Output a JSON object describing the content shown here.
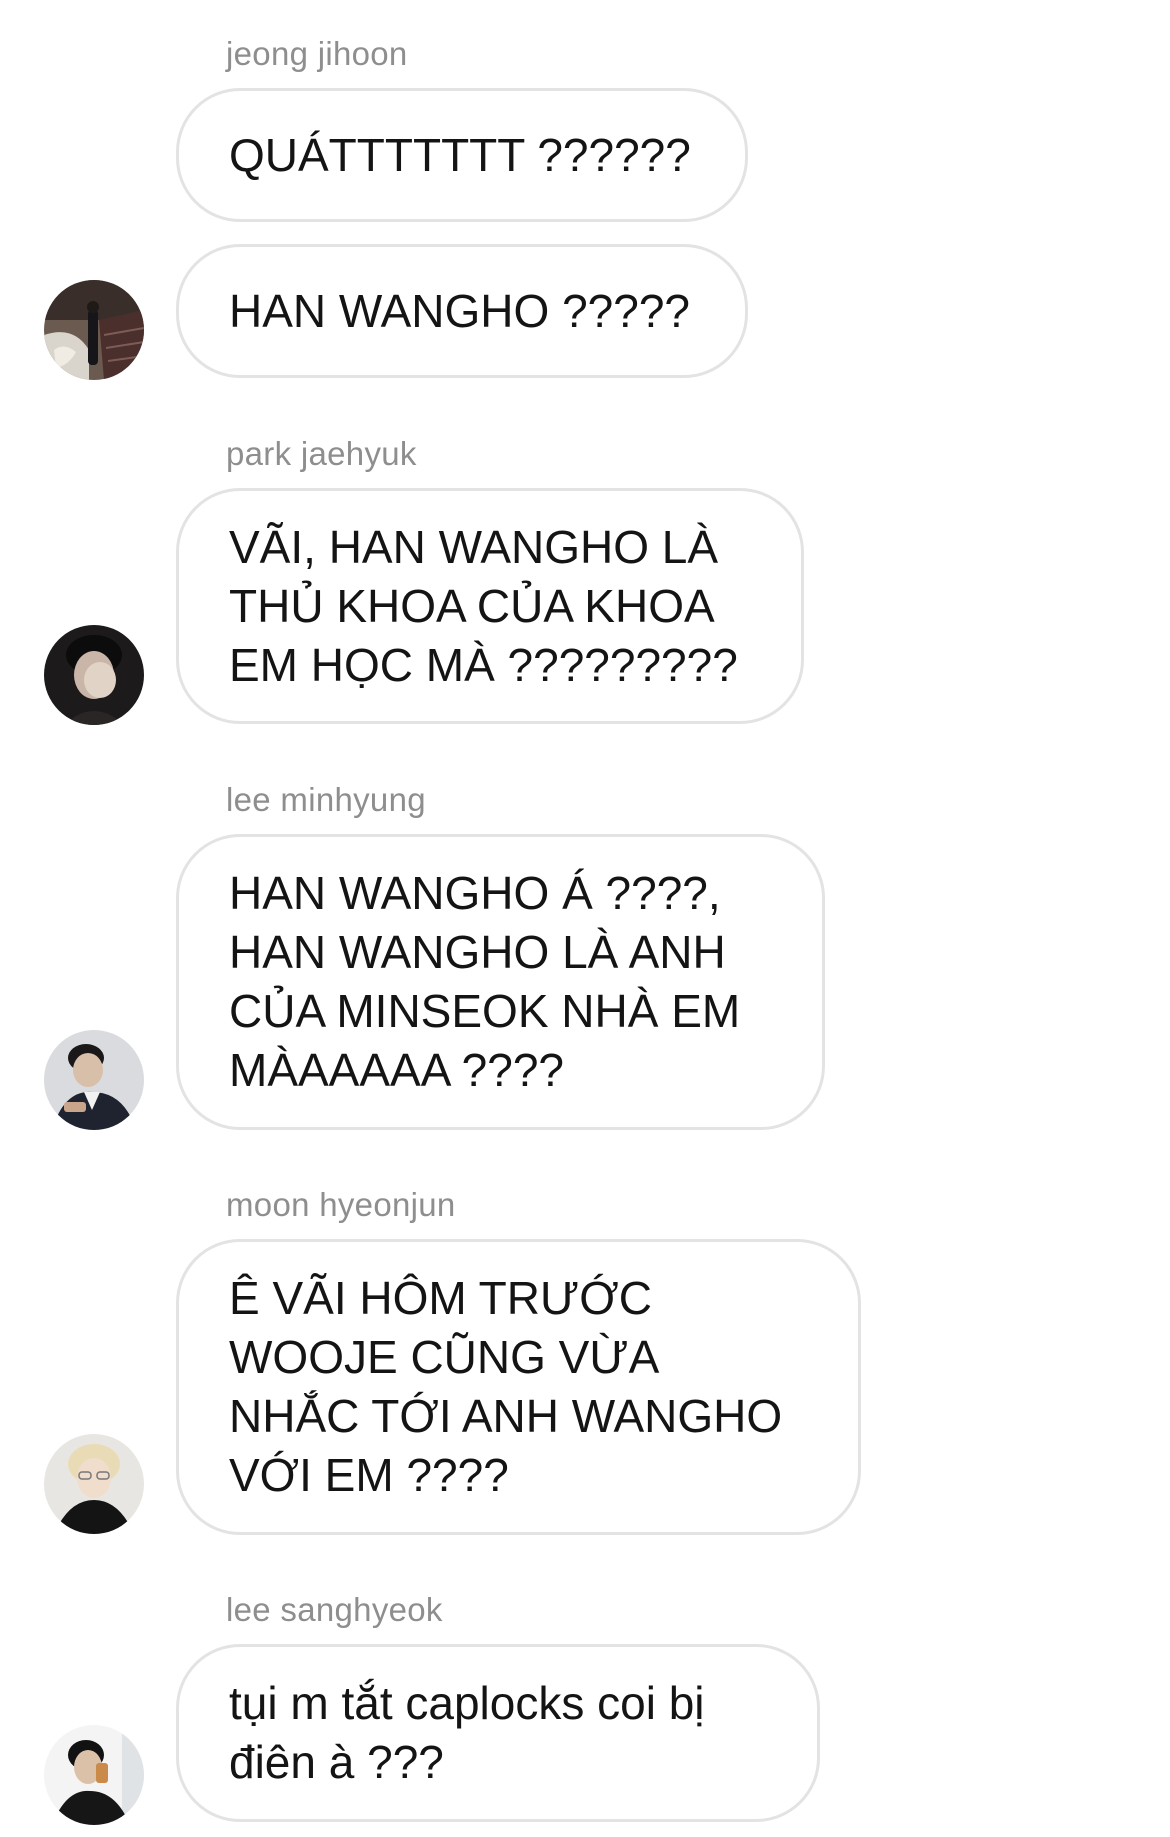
{
  "conversation": {
    "groups": [
      {
        "sender": "jeong jihoon",
        "messages": [
          "QUÁTTTTTTT ??????",
          "HAN WANGHO ?????"
        ],
        "avatar_icon": "avatar-photo-staircase"
      },
      {
        "sender": "park jaehyuk",
        "messages": [
          "VÃI, HAN WANGHO LÀ\nTHỦ KHOA CỦA KHOA\nEM HỌC MÀ ?????????"
        ],
        "avatar_icon": "avatar-photo-hand-over-face"
      },
      {
        "sender": "lee minhyung",
        "messages": [
          "HAN WANGHO Á ????,\nHAN WANGHO LÀ ANH\nCỦA MINSEOK NHÀ EM\nMÀAAAAA ????"
        ],
        "avatar_icon": "avatar-photo-suit"
      },
      {
        "sender": "moon hyeonjun",
        "messages": [
          "Ê VÃI HÔM TRƯỚC\nWOOJE CŨNG VỪA\nNHẮC TỚI ANH WANGHO\nVỚI EM ????"
        ],
        "avatar_icon": "avatar-photo-blond"
      },
      {
        "sender": "lee sanghyeok",
        "messages": [
          "tụi m tắt caplocks coi bị\nđiên à ???"
        ],
        "avatar_icon": "avatar-photo-drinking"
      }
    ]
  },
  "colors": {
    "background": "#ffffff",
    "bubble_border": "#e3e3e3",
    "sender_name": "#8e8e8e",
    "message_text": "#141414"
  }
}
